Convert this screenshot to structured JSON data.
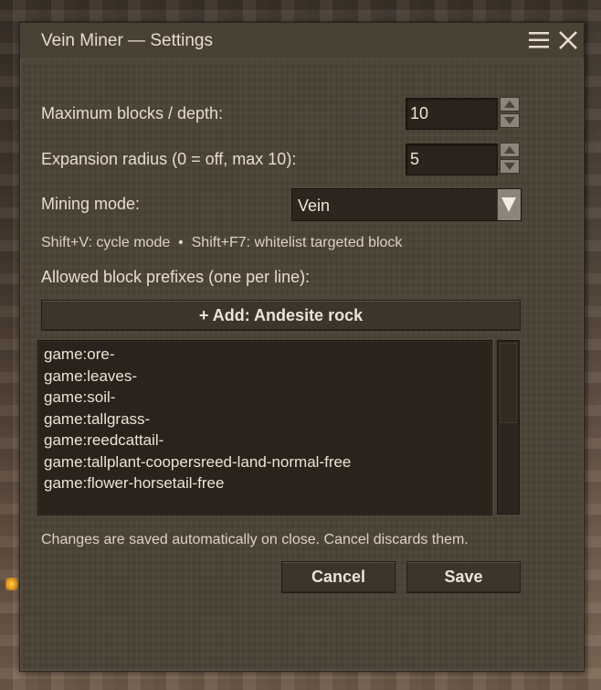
{
  "window": {
    "title": "Vein Miner — Settings"
  },
  "max_blocks": {
    "label": "Maximum blocks / depth:",
    "value": "10"
  },
  "expansion": {
    "label": "Expansion radius (0 = off, max 10):",
    "value": "5"
  },
  "mining_mode": {
    "label": "Mining mode:",
    "value": "Vein"
  },
  "hotkeys": {
    "text": "Shift+V: cycle mode  •  Shift+F7: whitelist targeted block"
  },
  "prefixes": {
    "label": "Allowed block prefixes (one per line):",
    "add_button": "+ Add: Andesite rock",
    "lines": [
      "game:ore-",
      "game:leaves-",
      "game:soil-",
      "game:tallgrass-",
      "game:reedcattail-",
      "game:tallplant-coopersreed-land-normal-free",
      "game:flower-horsetail-free"
    ]
  },
  "footer": {
    "note": "Changes are saved automatically on close. Cancel discards them.",
    "cancel": "Cancel",
    "save": "Save"
  },
  "colors": {
    "panel": "#4b4236",
    "text": "#e6ddcc",
    "field": "#2b241d",
    "stepper": "#8d857a"
  }
}
